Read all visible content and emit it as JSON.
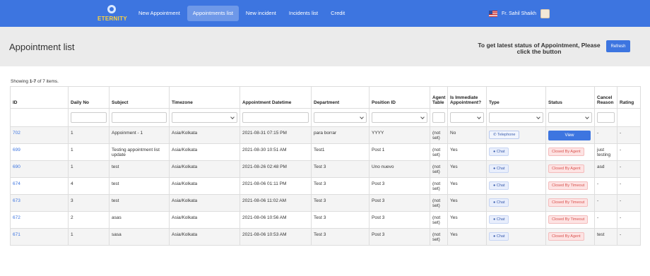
{
  "brand": {
    "logo_text": "ETERNITY"
  },
  "nav": [
    {
      "label": "New Appointment",
      "active": false
    },
    {
      "label": "Appointments list",
      "active": true
    },
    {
      "label": "New incident",
      "active": false
    },
    {
      "label": "Incidents list",
      "active": false
    },
    {
      "label": "Credit",
      "active": false
    }
  ],
  "user": {
    "name": "Fr. Sahil Shaikh"
  },
  "page": {
    "title": "Appointment list",
    "refresh_message": "To get latest status of Appointment, Please click the button",
    "refresh_button": "Refresh",
    "summary_prefix": "Showing ",
    "summary_range": "1-7",
    "summary_suffix": " of 7 items."
  },
  "table": {
    "columns": [
      "ID",
      "Daily No",
      "Subject",
      "Timezone",
      "Appointment Datetime",
      "Department",
      "Position ID",
      "Agent Table",
      "Is Immediate Appointment?",
      "Type",
      "Status",
      "Cancel Reason",
      "Rating"
    ],
    "rows": [
      {
        "id": "702",
        "daily_no": "1",
        "subject": "Appoinment - 1",
        "timezone": "Asia/Kolkata",
        "datetime": "2021-08-31 07:15 PM",
        "department": "para borrar",
        "position": "YYYY",
        "agent": "(not set)",
        "immediate": "No",
        "type": "Telephone",
        "status": "View",
        "cancel_reason": "-",
        "rating": "-"
      },
      {
        "id": "699",
        "daily_no": "1",
        "subject": "Testing appointment list update",
        "timezone": "Asia/Kolkata",
        "datetime": "2021-08-30 10:51 AM",
        "department": "Test1",
        "position": "Post 1",
        "agent": "(not set)",
        "immediate": "Yes",
        "type": "Chat",
        "status": "Closed By Agent",
        "cancel_reason": "just testing",
        "rating": "-"
      },
      {
        "id": "690",
        "daily_no": "1",
        "subject": "test",
        "timezone": "Asia/Kolkata",
        "datetime": "2021-08-26 02:48 PM",
        "department": "Test 3",
        "position": "Uno nuevo",
        "agent": "(not set)",
        "immediate": "Yes",
        "type": "Chat",
        "status": "Closed By Agent",
        "cancel_reason": "asd",
        "rating": "-"
      },
      {
        "id": "674",
        "daily_no": "4",
        "subject": "test",
        "timezone": "Asia/Kolkata",
        "datetime": "2021-08-06 01:11 PM",
        "department": "Test 3",
        "position": "Post 3",
        "agent": "(not set)",
        "immediate": "Yes",
        "type": "Chat",
        "status": "Closed By Timeout",
        "cancel_reason": "-",
        "rating": "-"
      },
      {
        "id": "673",
        "daily_no": "3",
        "subject": "test",
        "timezone": "Asia/Kolkata",
        "datetime": "2021-08-06 11:02 AM",
        "department": "Test 3",
        "position": "Post 3",
        "agent": "(not set)",
        "immediate": "Yes",
        "type": "Chat",
        "status": "Closed By Timeout",
        "cancel_reason": "-",
        "rating": "-"
      },
      {
        "id": "672",
        "daily_no": "2",
        "subject": "asas",
        "timezone": "Asia/Kolkata",
        "datetime": "2021-08-06 10:56 AM",
        "department": "Test 3",
        "position": "Post 3",
        "agent": "(not set)",
        "immediate": "Yes",
        "type": "Chat",
        "status": "Closed By Timeout",
        "cancel_reason": "-",
        "rating": "-"
      },
      {
        "id": "671",
        "daily_no": "1",
        "subject": "sasa",
        "timezone": "Asia/Kolkata",
        "datetime": "2021-08-06 10:53 AM",
        "department": "Test 3",
        "position": "Post 3",
        "agent": "(not set)",
        "immediate": "Yes",
        "type": "Chat",
        "status": "Closed By Agent",
        "cancel_reason": "test",
        "rating": "-"
      }
    ]
  },
  "colors": {
    "primary": "#3d75e0",
    "header_band": "#ebebeb",
    "status_red": "#d9534f",
    "row_stripe": "#f4f4f4"
  },
  "icons": {
    "chat": "chat-bubble-icon",
    "phone": "phone-icon"
  }
}
